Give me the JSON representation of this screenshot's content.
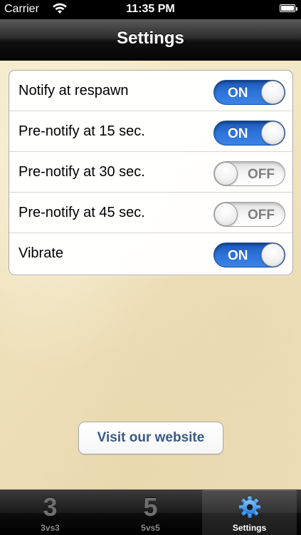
{
  "status_bar": {
    "carrier": "Carrier",
    "time": "11:35 PM",
    "wifi_icon": "wifi-icon",
    "battery_icon": "battery-icon"
  },
  "nav": {
    "title": "Settings"
  },
  "settings": {
    "items": [
      {
        "label": "Notify at respawn",
        "state": "ON"
      },
      {
        "label": "Pre-notify at 15 sec.",
        "state": "ON"
      },
      {
        "label": "Pre-notify at 30 sec.",
        "state": "OFF"
      },
      {
        "label": "Pre-notify at 45 sec.",
        "state": "OFF"
      },
      {
        "label": "Vibrate",
        "state": "ON"
      }
    ]
  },
  "website_button": {
    "label": "Visit our website"
  },
  "tab_bar": {
    "tabs": [
      {
        "glyph": "3",
        "label": "3vs3",
        "active": false
      },
      {
        "glyph": "5",
        "label": "5vs5",
        "active": false
      },
      {
        "icon": "gear-icon",
        "label": "Settings",
        "active": true
      }
    ]
  },
  "colors": {
    "switch_on": "#2e73d8",
    "link_text": "#3b5a87",
    "parchment": "#f0e4c0"
  }
}
